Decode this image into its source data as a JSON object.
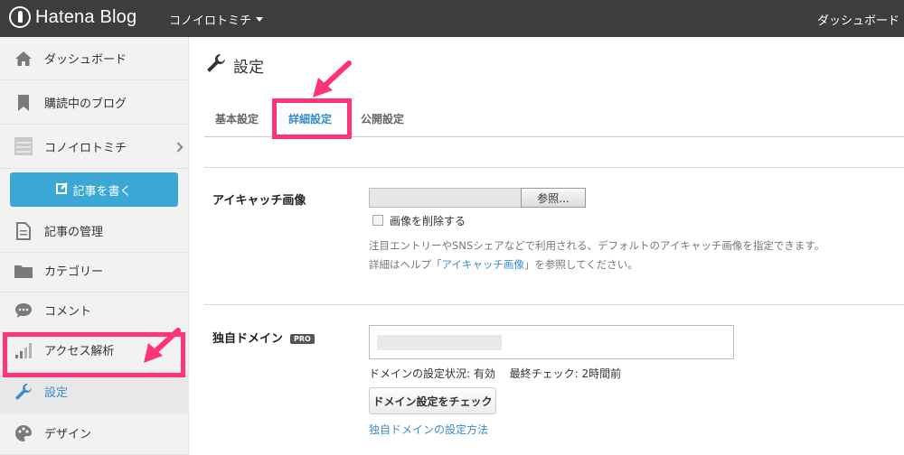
{
  "header": {
    "logo_text": "Hatena Blog",
    "blog_name": "コノイロトミチ",
    "dashboard_link": "ダッシュボード"
  },
  "sidebar": {
    "items": [
      {
        "label": "ダッシュボード",
        "icon": "home-icon"
      },
      {
        "label": "購読中のブログ",
        "icon": "bookmark-icon"
      },
      {
        "label": "コノイロトミチ",
        "icon": "blog-thumbnail-icon"
      },
      {
        "label": "記事の管理",
        "icon": "document-icon"
      },
      {
        "label": "カテゴリー",
        "icon": "folder-icon"
      },
      {
        "label": "コメント",
        "icon": "comment-icon"
      },
      {
        "label": "アクセス解析",
        "icon": "bar-chart-icon"
      },
      {
        "label": "設定",
        "icon": "wrench-icon"
      },
      {
        "label": "デザイン",
        "icon": "palette-icon"
      }
    ],
    "write_button": "記事を書く"
  },
  "main": {
    "title": "設定",
    "tabs": [
      {
        "label": "基本設定"
      },
      {
        "label": "詳細設定"
      },
      {
        "label": "公開設定"
      }
    ],
    "eyecatch": {
      "label": "アイキャッチ画像",
      "browse_button": "参照...",
      "delete_checkbox": "画像を削除する",
      "help_line1": "注目エントリーやSNSシェアなどで利用される、デフォルトのアイキャッチ画像を指定できます。",
      "help_line2_prefix": "詳細はヘルプ「",
      "help_link": "アイキャッチ画像",
      "help_line2_suffix": "」を参照してください。"
    },
    "domain": {
      "label": "独自ドメイン",
      "badge": "PRO",
      "status": "ドメインの設定状況: 有効　 最終チェック: 2時間前",
      "check_button": "ドメイン設定をチェック",
      "setup_link": "独自ドメインの設定方法"
    }
  },
  "colors": {
    "topbar": "#3d3d3d",
    "accent": "#3ba7d4",
    "link": "#3a8cc9",
    "highlight": "#ff3377"
  }
}
